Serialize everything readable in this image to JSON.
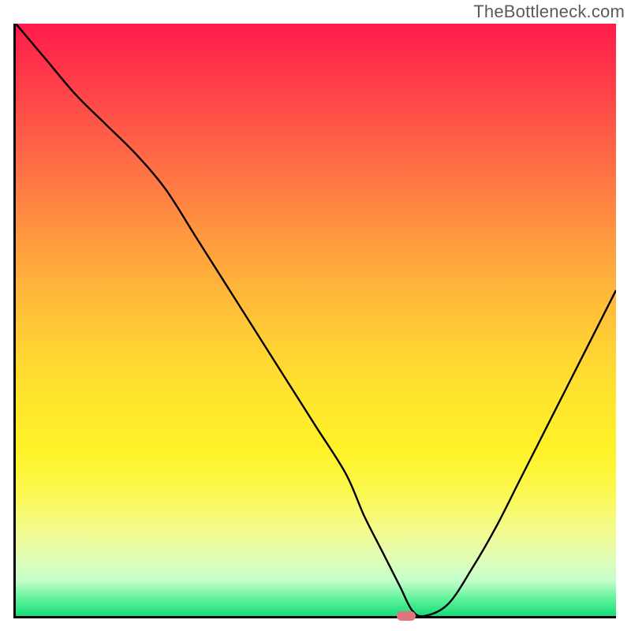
{
  "watermark": "TheBottleneck.com",
  "colors": {
    "border": "#000000",
    "curve": "#000000",
    "marker": "#e2747e",
    "gradient_top": "#ff1a4b",
    "gradient_bottom": "#15dd7a"
  },
  "chart_data": {
    "type": "line",
    "title": "",
    "xlabel": "",
    "ylabel": "",
    "xlim": [
      0,
      100
    ],
    "ylim": [
      0,
      100
    ],
    "x": [
      0,
      5,
      10,
      15,
      20,
      25,
      30,
      35,
      40,
      45,
      50,
      55,
      58,
      61,
      64,
      66,
      68,
      72,
      76,
      80,
      84,
      88,
      92,
      96,
      100
    ],
    "values": [
      100,
      94,
      88,
      83,
      78,
      72,
      64,
      56,
      48,
      40,
      32,
      24,
      17,
      11,
      5,
      1,
      0,
      2,
      8,
      15,
      23,
      31,
      39,
      47,
      55
    ],
    "marker": {
      "x": 65,
      "y": 0
    },
    "axes_visible": false,
    "background": "red-yellow-green vertical gradient"
  }
}
